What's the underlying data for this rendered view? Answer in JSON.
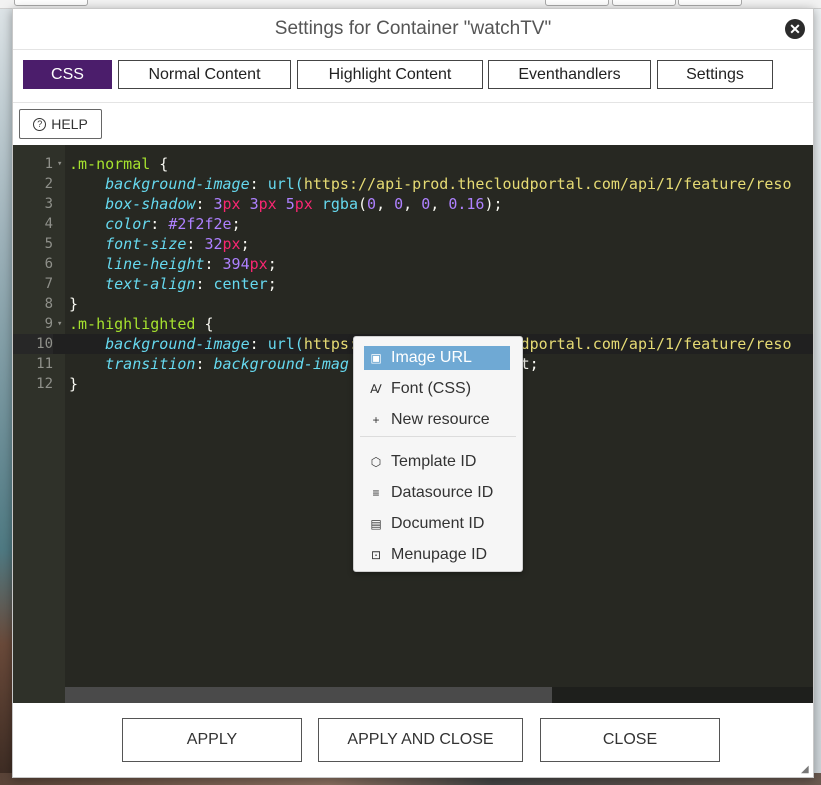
{
  "dialog": {
    "title": "Settings for Container \"watchTV\"",
    "close_icon": "close-icon"
  },
  "tabs": [
    {
      "label": "CSS",
      "active": true
    },
    {
      "label": "Normal Content",
      "active": false
    },
    {
      "label": "Highlight Content",
      "active": false
    },
    {
      "label": "Eventhandlers",
      "active": false
    },
    {
      "label": "Settings",
      "active": false
    }
  ],
  "help": {
    "label": "HELP",
    "icon": "help-icon"
  },
  "editor": {
    "active_line": 10,
    "line_numbers": [
      "1",
      "2",
      "3",
      "4",
      "5",
      "6",
      "7",
      "8",
      "9",
      "10",
      "11",
      "12"
    ],
    "lines": [
      [
        {
          "t": ".m-normal",
          "c": "sel"
        },
        {
          "t": " {",
          "c": "punc"
        }
      ],
      [
        {
          "t": "    ",
          "c": "punc"
        },
        {
          "t": "background-image",
          "c": "prop"
        },
        {
          "t": ": ",
          "c": "punc"
        },
        {
          "t": "url(",
          "c": "fn"
        },
        {
          "t": "https://api-prod.thecloudportal.com/api/1/feature/reso",
          "c": "str"
        }
      ],
      [
        {
          "t": "    ",
          "c": "punc"
        },
        {
          "t": "box-shadow",
          "c": "prop"
        },
        {
          "t": ": ",
          "c": "punc"
        },
        {
          "t": "3",
          "c": "num"
        },
        {
          "t": "px",
          "c": "unit"
        },
        {
          "t": " ",
          "c": "punc"
        },
        {
          "t": "3",
          "c": "num"
        },
        {
          "t": "px",
          "c": "unit"
        },
        {
          "t": " ",
          "c": "punc"
        },
        {
          "t": "5",
          "c": "num"
        },
        {
          "t": "px",
          "c": "unit"
        },
        {
          "t": " ",
          "c": "punc"
        },
        {
          "t": "rgba",
          "c": "fn"
        },
        {
          "t": "(",
          "c": "punc"
        },
        {
          "t": "0",
          "c": "num"
        },
        {
          "t": ", ",
          "c": "punc"
        },
        {
          "t": "0",
          "c": "num"
        },
        {
          "t": ", ",
          "c": "punc"
        },
        {
          "t": "0",
          "c": "num"
        },
        {
          "t": ", ",
          "c": "punc"
        },
        {
          "t": "0.16",
          "c": "num"
        },
        {
          "t": ");",
          "c": "punc"
        }
      ],
      [
        {
          "t": "    ",
          "c": "punc"
        },
        {
          "t": "color",
          "c": "prop"
        },
        {
          "t": ": ",
          "c": "punc"
        },
        {
          "t": "#2f2f2e",
          "c": "num"
        },
        {
          "t": ";",
          "c": "punc"
        }
      ],
      [
        {
          "t": "    ",
          "c": "punc"
        },
        {
          "t": "font-size",
          "c": "prop"
        },
        {
          "t": ": ",
          "c": "punc"
        },
        {
          "t": "32",
          "c": "num"
        },
        {
          "t": "px",
          "c": "unit"
        },
        {
          "t": ";",
          "c": "punc"
        }
      ],
      [
        {
          "t": "    ",
          "c": "punc"
        },
        {
          "t": "line-height",
          "c": "prop"
        },
        {
          "t": ": ",
          "c": "punc"
        },
        {
          "t": "394",
          "c": "num"
        },
        {
          "t": "px",
          "c": "unit"
        },
        {
          "t": ";",
          "c": "punc"
        }
      ],
      [
        {
          "t": "    ",
          "c": "punc"
        },
        {
          "t": "text-align",
          "c": "prop"
        },
        {
          "t": ": ",
          "c": "punc"
        },
        {
          "t": "center",
          "c": "kw"
        },
        {
          "t": ";",
          "c": "punc"
        }
      ],
      [
        {
          "t": "}",
          "c": "punc"
        }
      ],
      [
        {
          "t": ".m-highlighted",
          "c": "sel"
        },
        {
          "t": " {",
          "c": "punc"
        }
      ],
      [
        {
          "t": "    ",
          "c": "punc"
        },
        {
          "t": "background-image",
          "c": "prop"
        },
        {
          "t": ": ",
          "c": "punc"
        },
        {
          "t": "url(",
          "c": "fn"
        },
        {
          "t": "https://api-prod.thecloudportal.com/api/1/feature/reso",
          "c": "str"
        }
      ],
      [
        {
          "t": "    ",
          "c": "punc"
        },
        {
          "t": "transition",
          "c": "prop"
        },
        {
          "t": ": ",
          "c": "punc"
        },
        {
          "t": "background-imag",
          "c": "prop"
        },
        {
          "t": "                   ",
          "c": "punc"
        },
        {
          "t": "t;",
          "c": "punc"
        }
      ],
      [
        {
          "t": "}",
          "c": "punc"
        }
      ]
    ]
  },
  "context_menu": {
    "items": [
      {
        "label": "Image URL",
        "icon": "image-icon",
        "glyph": "▣",
        "highlighted": true
      },
      {
        "label": "Font (CSS)",
        "icon": "font-icon",
        "glyph": "Ꜹ",
        "highlighted": false
      },
      {
        "label": "New resource",
        "icon": "plus-icon",
        "glyph": "+",
        "highlighted": false
      },
      {
        "label": "Template ID",
        "icon": "cube-icon",
        "glyph": "⬡",
        "highlighted": false
      },
      {
        "label": "Datasource ID",
        "icon": "database-icon",
        "glyph": "≡",
        "highlighted": false
      },
      {
        "label": "Document ID",
        "icon": "document-icon",
        "glyph": "▤",
        "highlighted": false
      },
      {
        "label": "Menupage ID",
        "icon": "tv-icon",
        "glyph": "⊡",
        "highlighted": false
      }
    ]
  },
  "footer": {
    "apply": "APPLY",
    "apply_close": "APPLY AND CLOSE",
    "close": "CLOSE"
  },
  "colors": {
    "accent": "#4b1d6b",
    "menu_highlight": "#6fa9d4",
    "editor_bg": "#272822"
  }
}
